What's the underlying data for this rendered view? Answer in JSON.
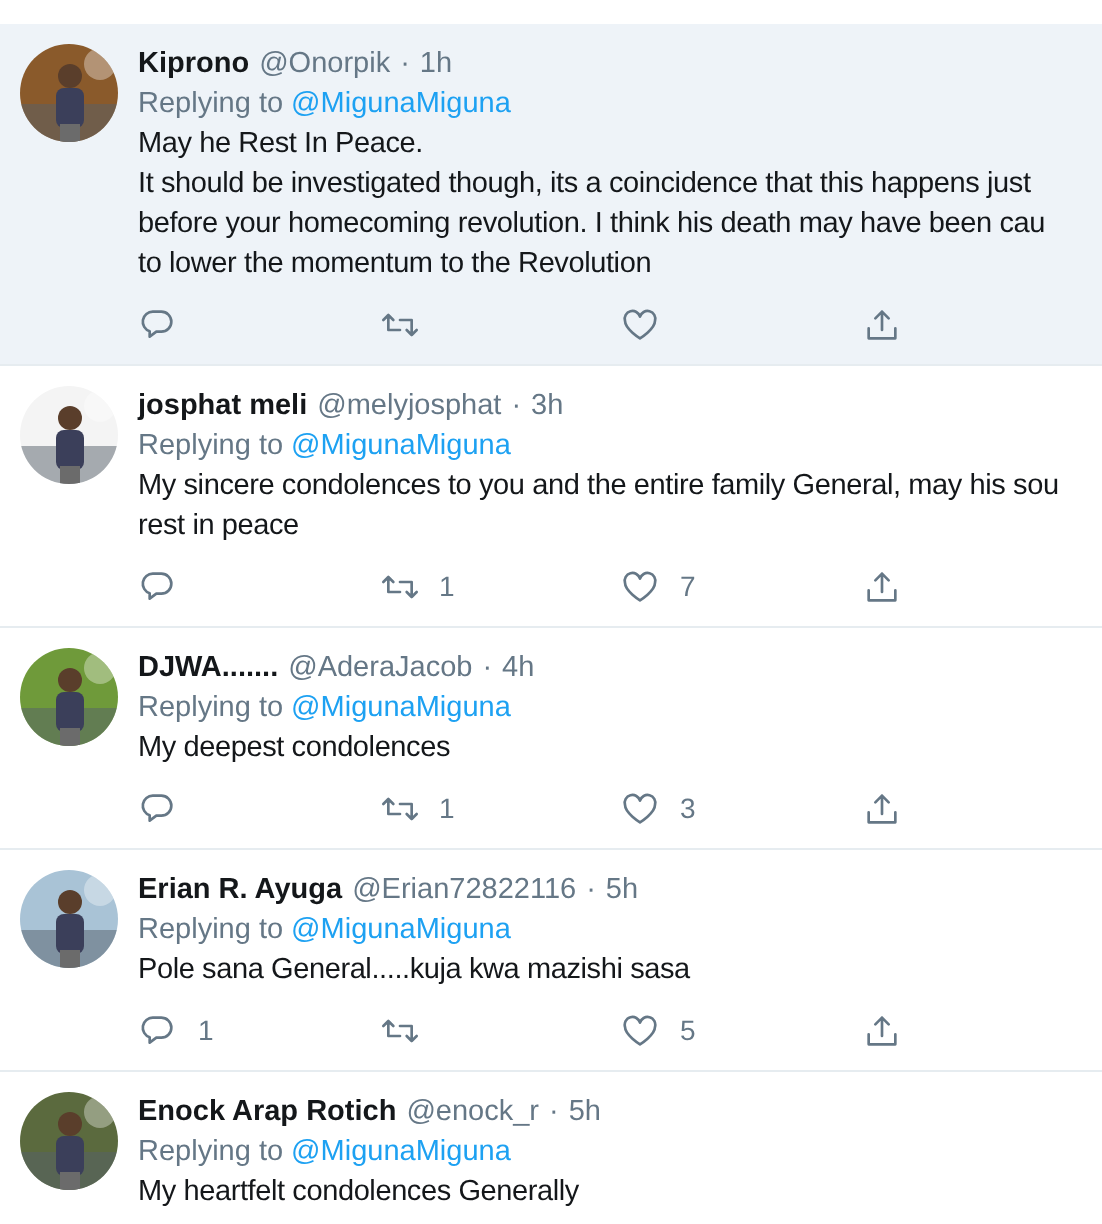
{
  "tweets": [
    {
      "name": "Kiprono",
      "handle": "@Onorpik",
      "separator": "·",
      "time": "1h",
      "highlighted": true,
      "avatar": {
        "kind": "picture"
      },
      "replying_label": "Replying to",
      "replying_to": "@MigunaMiguna",
      "body": [
        "May he Rest In Peace.",
        "It should be investigated though, its a coincidence that this happens just",
        "before your homecoming revolution. I think his death may have been cau",
        "to lower the momentum to the Revolution"
      ],
      "actions": [
        {
          "kind": "reply"
        },
        {
          "kind": "retweet"
        },
        {
          "kind": "like"
        },
        {
          "kind": "share"
        }
      ]
    },
    {
      "name": "josphat meli",
      "handle": "@melyjosphat",
      "separator": "·",
      "time": "3h",
      "highlighted": false,
      "avatar": {
        "kind": "picture"
      },
      "replying_label": "Replying to",
      "replying_to": "@MigunaMiguna",
      "body": [
        "My sincere condolences to you and the entire family General, may his sou",
        "rest in peace"
      ],
      "actions": [
        {
          "kind": "reply"
        },
        {
          "kind": "retweet",
          "count": "1"
        },
        {
          "kind": "like",
          "count": "7"
        },
        {
          "kind": "share"
        }
      ]
    },
    {
      "name": "DJWA.......",
      "handle": "@AderaJacob",
      "separator": "·",
      "time": "4h",
      "highlighted": false,
      "avatar": {
        "kind": "picture"
      },
      "replying_label": "Replying to",
      "replying_to": "@MigunaMiguna",
      "body": [
        "My deepest condolences"
      ],
      "actions": [
        {
          "kind": "reply"
        },
        {
          "kind": "retweet",
          "count": "1"
        },
        {
          "kind": "like",
          "count": "3"
        },
        {
          "kind": "share"
        }
      ]
    },
    {
      "name": "Erian R. Ayuga",
      "handle": "@Erian72822116",
      "separator": "·",
      "time": "5h",
      "highlighted": false,
      "avatar": {
        "kind": "picture"
      },
      "replying_label": "Replying to",
      "replying_to": "@MigunaMiguna",
      "body": [
        "Pole sana General.....kuja kwa mazishi sasa"
      ],
      "actions": [
        {
          "kind": "reply",
          "count": "1"
        },
        {
          "kind": "retweet"
        },
        {
          "kind": "like",
          "count": "5"
        },
        {
          "kind": "share"
        }
      ]
    },
    {
      "name": "Enock Arap Rotich",
      "handle": "@enock_r",
      "separator": "·",
      "time": "5h",
      "highlighted": false,
      "avatar": {
        "kind": "picture"
      },
      "replying_label": "Replying to",
      "replying_to": "@MigunaMiguna",
      "body": [
        "My heartfelt condolences Generally"
      ]
    }
  ]
}
